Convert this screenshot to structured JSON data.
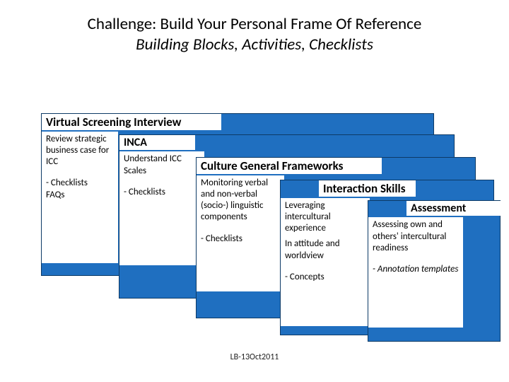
{
  "title": "Challenge: Build Your Personal Frame Of Reference",
  "subtitle": "Building Blocks, Activities, Checklists",
  "footer": "LB-13Oct2011",
  "bands": {
    "b1": {
      "head": "Virtual Screening Interview",
      "p1": "Review strategic business case for ICC",
      "p2": "- Checklists\n  FAQs"
    },
    "b2": {
      "head": "INCA",
      "p1": "Understand  ICC Scales",
      "p2": "- Checklists"
    },
    "b3": {
      "head": "Culture General Frameworks",
      "p1": "Monitoring verbal and non-verbal (socio-) linguistic components",
      "p2": "- Checklists"
    },
    "b4": {
      "head": "Interaction Skills",
      "p1": "Leveraging intercultural experience",
      "p2": "In attitude and worldview",
      "p3": "- Concepts"
    },
    "b5": {
      "head": "Assessment",
      "p1": "Assessing own and others' intercultural readiness",
      "p2": "- Annotation templates"
    }
  }
}
